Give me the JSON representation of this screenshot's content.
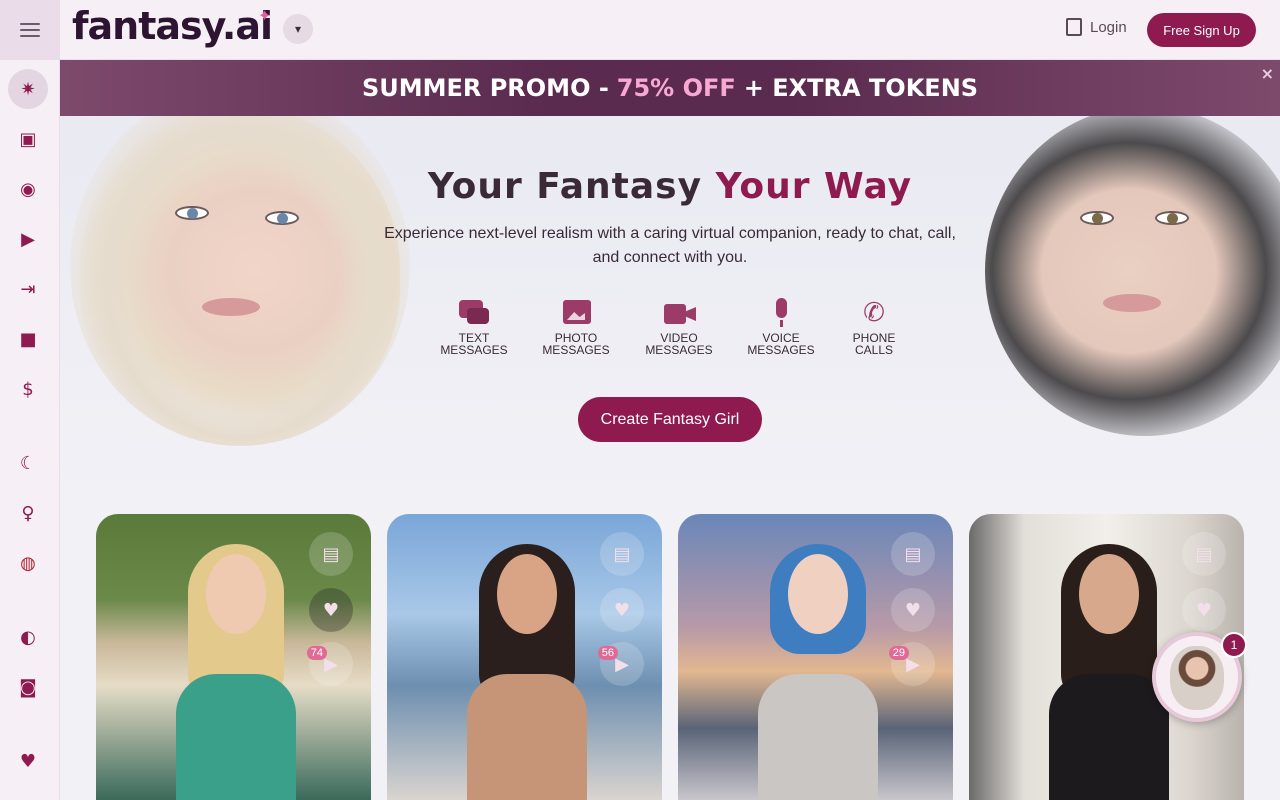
{
  "header": {
    "logo_text": "fantasy.ai",
    "login_label": "Login",
    "signup_label": "Free Sign Up"
  },
  "sidebar": {
    "items": [
      {
        "name": "ai-sparkle-icon"
      },
      {
        "name": "gallery-icon"
      },
      {
        "name": "compass-icon"
      },
      {
        "name": "play-icon"
      },
      {
        "name": "login-icon"
      },
      {
        "name": "gift-icon"
      },
      {
        "name": "dollar-icon"
      },
      {
        "name": "moon-icon"
      },
      {
        "name": "gender-icon"
      },
      {
        "name": "us-flag-icon"
      },
      {
        "name": "globe-icon"
      },
      {
        "name": "camera-icon"
      },
      {
        "name": "heart-icon"
      }
    ]
  },
  "promo": {
    "prefix": "SUMMER PROMO -",
    "highlight": "75% OFF",
    "suffix": "+ EXTRA TOKENS",
    "close": "×"
  },
  "hero": {
    "title_part1": "Your Fantasy",
    "title_part2": "Your Way",
    "subtitle": "Experience next-level realism with a caring virtual companion, ready to chat, call, and connect with you.",
    "features": [
      {
        "line1": "TEXT",
        "line2": "MESSAGES",
        "icon": "chat-icon"
      },
      {
        "line1": "PHOTO",
        "line2": "MESSAGES",
        "icon": "photo-icon"
      },
      {
        "line1": "VIDEO",
        "line2": "MESSAGES",
        "icon": "video-icon"
      },
      {
        "line1": "VOICE",
        "line2": "MESSAGES",
        "icon": "microphone-icon"
      },
      {
        "line1": "PHONE",
        "line2": "CALLS",
        "icon": "phone-icon"
      }
    ],
    "cta_label": "Create Fantasy Girl"
  },
  "cards": [
    {
      "video_count": "74"
    },
    {
      "video_count": "56"
    },
    {
      "video_count": "29"
    },
    {
      "video_count": ""
    }
  ],
  "chat_fab": {
    "count": "1"
  },
  "colors": {
    "brand": "#8f1a4f",
    "accent_pink": "#f9a8d4"
  }
}
